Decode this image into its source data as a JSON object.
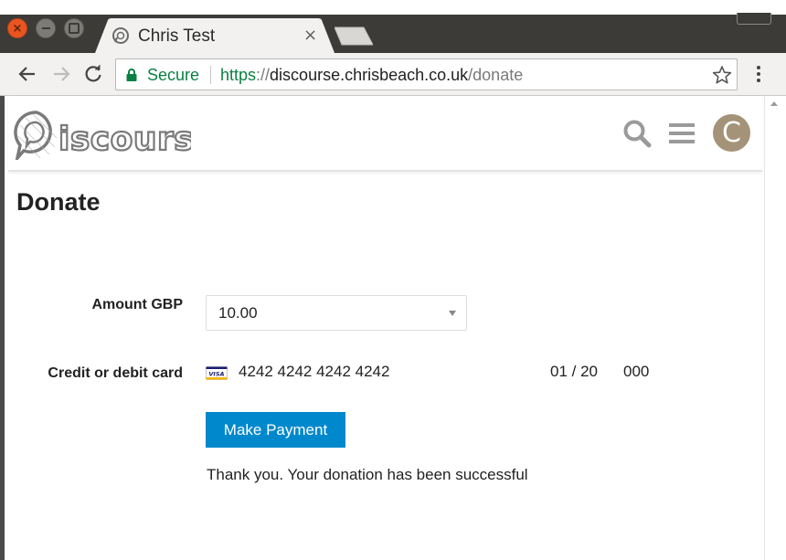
{
  "browser": {
    "tab": {
      "title": "Chris Test",
      "close_glyph": "×",
      "favicon": "discourse-favicon-icon"
    },
    "window_controls": {
      "close_glyph": "×"
    },
    "omnibox": {
      "secure_label": "Secure",
      "url_scheme": "https",
      "url_separator": "://",
      "url_host": "discourse.chrisbeach.co.uk",
      "url_path": "/donate"
    },
    "colors": {
      "secure_green": "#0b8043",
      "chrome_dark": "#3c3b37",
      "toolbar": "#f2f1f0"
    }
  },
  "site": {
    "logo_alt": "Discourse",
    "avatar_letter": "C",
    "avatar_color": "#a49378"
  },
  "page": {
    "title": "Donate",
    "amount": {
      "label": "Amount GBP",
      "value": "10.00"
    },
    "card": {
      "label": "Credit or debit card",
      "brand_icon": "visa-icon",
      "number": "4242 4242 4242 4242",
      "expiry": "01 / 20",
      "cvc": "000"
    },
    "pay_button": {
      "label": "Make Payment",
      "color": "#0088cc"
    },
    "success_message": "Thank you. Your donation has been successful"
  }
}
